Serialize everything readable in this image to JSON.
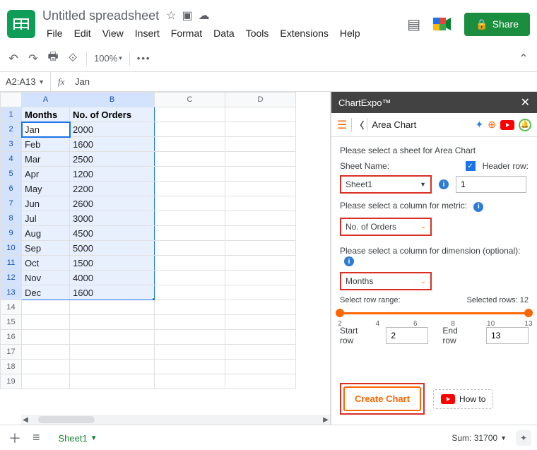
{
  "header": {
    "doc_title": "Untitled spreadsheet",
    "menu": [
      "File",
      "Edit",
      "View",
      "Insert",
      "Format",
      "Data",
      "Tools",
      "Extensions",
      "Help"
    ],
    "share_label": "Share"
  },
  "toolbar": {
    "zoom": "100%"
  },
  "formula_bar": {
    "name_box": "A2:A13",
    "fx_label": "fx",
    "content": "Jan"
  },
  "columns": [
    "A",
    "B",
    "C",
    "D"
  ],
  "table": {
    "headers": [
      "Months",
      "No. of Orders"
    ],
    "rows": [
      [
        "Jan",
        "2000"
      ],
      [
        "Feb",
        "1600"
      ],
      [
        "Mar",
        "2500"
      ],
      [
        "Apr",
        "1200"
      ],
      [
        "May",
        "2200"
      ],
      [
        "Jun",
        "2600"
      ],
      [
        "Jul",
        "3000"
      ],
      [
        "Aug",
        "4500"
      ],
      [
        "Sep",
        "5000"
      ],
      [
        "Oct",
        "1500"
      ],
      [
        "Nov",
        "4000"
      ],
      [
        "Dec",
        "1600"
      ]
    ],
    "total_rows_shown": 19
  },
  "sidebar": {
    "title": "ChartExpo™",
    "breadcrumb": "Area Chart",
    "prompt_sheet": "Please select a sheet for Area Chart",
    "sheet_name_label": "Sheet Name:",
    "sheet_name_value": "Sheet1",
    "header_row_label": "Header row:",
    "header_row_checked": true,
    "header_row_value": "1",
    "prompt_metric": "Please select a column for metric:",
    "metric_value": "No. of Orders",
    "prompt_dimension": "Please select a column for dimension (optional):",
    "dimension_value": "Months",
    "row_range_label": "Select row range:",
    "selected_rows_label": "Selected rows: 12",
    "slider_ticks": [
      "2",
      "4",
      "6",
      "8",
      "10",
      "13"
    ],
    "start_row_label": "Start row",
    "start_row_value": "2",
    "end_row_label": "End row",
    "end_row_value": "13",
    "create_label": "Create Chart",
    "howto_label": "How to"
  },
  "bottom": {
    "sheet_name": "Sheet1",
    "sum_label": "Sum: 31700"
  },
  "chart_data": {
    "type": "area",
    "title": "Area Chart",
    "categories": [
      "Jan",
      "Feb",
      "Mar",
      "Apr",
      "May",
      "Jun",
      "Jul",
      "Aug",
      "Sep",
      "Oct",
      "Nov",
      "Dec"
    ],
    "series": [
      {
        "name": "No. of Orders",
        "values": [
          2000,
          1600,
          2500,
          1200,
          2200,
          2600,
          3000,
          4500,
          5000,
          1500,
          4000,
          1600
        ]
      }
    ],
    "xlabel": "Months",
    "ylabel": "No. of Orders"
  }
}
